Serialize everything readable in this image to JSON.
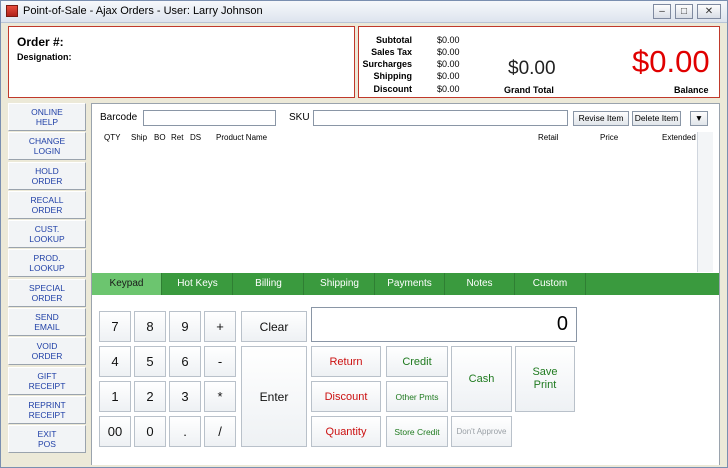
{
  "window": {
    "title": "Point-of-Sale - Ajax Orders - User: Larry Johnson"
  },
  "order": {
    "order_label": "Order #:",
    "designation_label": "Designation:"
  },
  "totals": {
    "rows": [
      {
        "label": "Subtotal",
        "value": "$0.00"
      },
      {
        "label": "Sales Tax",
        "value": "$0.00"
      },
      {
        "label": "Surcharges",
        "value": "$0.00"
      },
      {
        "label": "Shipping",
        "value": "$0.00"
      },
      {
        "label": "Discount",
        "value": "$0.00"
      }
    ],
    "grand_total_amount": "$0.00",
    "grand_total_label": "Grand Total",
    "balance_amount": "$0.00",
    "balance_label": "Balance"
  },
  "sidebar": {
    "items": [
      {
        "label": "ONLINE\nHELP"
      },
      {
        "label": "CHANGE\nLOGIN"
      },
      {
        "label": "HOLD\nORDER"
      },
      {
        "label": "RECALL\nORDER"
      },
      {
        "label": "CUST.\nLOOKUP"
      },
      {
        "label": "PROD.\nLOOKUP"
      },
      {
        "label": "SPECIAL\nORDER"
      },
      {
        "label": "SEND\nEMAIL"
      },
      {
        "label": "VOID\nORDER"
      },
      {
        "label": "GIFT\nRECEIPT"
      },
      {
        "label": "REPRINT\nRECEIPT"
      },
      {
        "label": "EXIT\nPOS"
      }
    ]
  },
  "entry": {
    "barcode_label": "Barcode",
    "sku_label": "SKU",
    "revise_item": "Revise Item",
    "delete_item": "Delete Item"
  },
  "columns": {
    "qty": "QTY",
    "ship": "Ship",
    "bo": "BO",
    "ret": "Ret",
    "ds": "DS",
    "product_name": "Product Name",
    "retail": "Retail",
    "price": "Price",
    "extended": "Extended"
  },
  "tabs": [
    {
      "label": "Keypad"
    },
    {
      "label": "Hot Keys"
    },
    {
      "label": "Billing"
    },
    {
      "label": "Shipping"
    },
    {
      "label": "Payments"
    },
    {
      "label": "Notes"
    },
    {
      "label": "Custom"
    }
  ],
  "keypad": {
    "display_value": "0",
    "keys": [
      "7",
      "8",
      "9",
      "+",
      "4",
      "5",
      "6",
      "-",
      "1",
      "2",
      "3",
      "*",
      "00",
      "0",
      ".",
      "/"
    ],
    "clear": "Clear",
    "enter": "Enter",
    "return": "Return",
    "discount": "Discount",
    "quantity": "Quantity",
    "credit": "Credit",
    "other_pmts": "Other Pmts",
    "store_credit": "Store Credit",
    "cash": "Cash",
    "dont_approve": "Don't Approve",
    "save_print": "Save\nPrint"
  }
}
